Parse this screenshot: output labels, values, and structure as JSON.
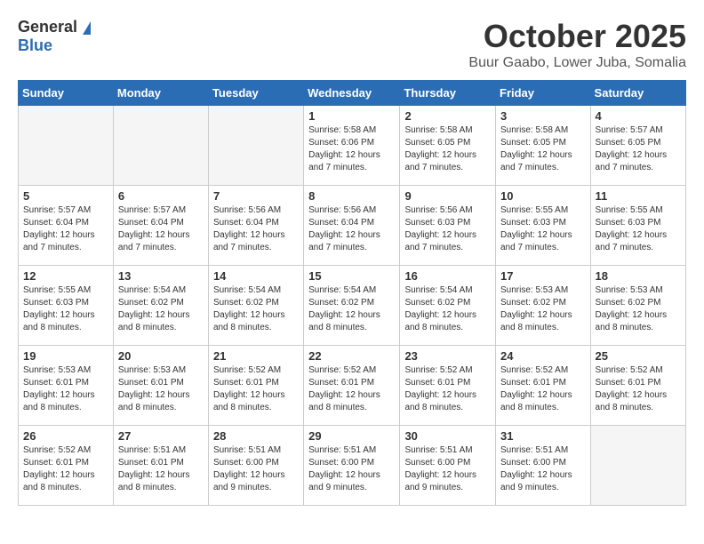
{
  "logo": {
    "general": "General",
    "blue": "Blue"
  },
  "header": {
    "month": "October 2025",
    "location": "Buur Gaabo, Lower Juba, Somalia"
  },
  "weekdays": [
    "Sunday",
    "Monday",
    "Tuesday",
    "Wednesday",
    "Thursday",
    "Friday",
    "Saturday"
  ],
  "weeks": [
    [
      {
        "day": "",
        "info": ""
      },
      {
        "day": "",
        "info": ""
      },
      {
        "day": "",
        "info": ""
      },
      {
        "day": "1",
        "info": "Sunrise: 5:58 AM\nSunset: 6:06 PM\nDaylight: 12 hours and 7 minutes."
      },
      {
        "day": "2",
        "info": "Sunrise: 5:58 AM\nSunset: 6:05 PM\nDaylight: 12 hours and 7 minutes."
      },
      {
        "day": "3",
        "info": "Sunrise: 5:58 AM\nSunset: 6:05 PM\nDaylight: 12 hours and 7 minutes."
      },
      {
        "day": "4",
        "info": "Sunrise: 5:57 AM\nSunset: 6:05 PM\nDaylight: 12 hours and 7 minutes."
      }
    ],
    [
      {
        "day": "5",
        "info": "Sunrise: 5:57 AM\nSunset: 6:04 PM\nDaylight: 12 hours and 7 minutes."
      },
      {
        "day": "6",
        "info": "Sunrise: 5:57 AM\nSunset: 6:04 PM\nDaylight: 12 hours and 7 minutes."
      },
      {
        "day": "7",
        "info": "Sunrise: 5:56 AM\nSunset: 6:04 PM\nDaylight: 12 hours and 7 minutes."
      },
      {
        "day": "8",
        "info": "Sunrise: 5:56 AM\nSunset: 6:04 PM\nDaylight: 12 hours and 7 minutes."
      },
      {
        "day": "9",
        "info": "Sunrise: 5:56 AM\nSunset: 6:03 PM\nDaylight: 12 hours and 7 minutes."
      },
      {
        "day": "10",
        "info": "Sunrise: 5:55 AM\nSunset: 6:03 PM\nDaylight: 12 hours and 7 minutes."
      },
      {
        "day": "11",
        "info": "Sunrise: 5:55 AM\nSunset: 6:03 PM\nDaylight: 12 hours and 7 minutes."
      }
    ],
    [
      {
        "day": "12",
        "info": "Sunrise: 5:55 AM\nSunset: 6:03 PM\nDaylight: 12 hours and 8 minutes."
      },
      {
        "day": "13",
        "info": "Sunrise: 5:54 AM\nSunset: 6:02 PM\nDaylight: 12 hours and 8 minutes."
      },
      {
        "day": "14",
        "info": "Sunrise: 5:54 AM\nSunset: 6:02 PM\nDaylight: 12 hours and 8 minutes."
      },
      {
        "day": "15",
        "info": "Sunrise: 5:54 AM\nSunset: 6:02 PM\nDaylight: 12 hours and 8 minutes."
      },
      {
        "day": "16",
        "info": "Sunrise: 5:54 AM\nSunset: 6:02 PM\nDaylight: 12 hours and 8 minutes."
      },
      {
        "day": "17",
        "info": "Sunrise: 5:53 AM\nSunset: 6:02 PM\nDaylight: 12 hours and 8 minutes."
      },
      {
        "day": "18",
        "info": "Sunrise: 5:53 AM\nSunset: 6:02 PM\nDaylight: 12 hours and 8 minutes."
      }
    ],
    [
      {
        "day": "19",
        "info": "Sunrise: 5:53 AM\nSunset: 6:01 PM\nDaylight: 12 hours and 8 minutes."
      },
      {
        "day": "20",
        "info": "Sunrise: 5:53 AM\nSunset: 6:01 PM\nDaylight: 12 hours and 8 minutes."
      },
      {
        "day": "21",
        "info": "Sunrise: 5:52 AM\nSunset: 6:01 PM\nDaylight: 12 hours and 8 minutes."
      },
      {
        "day": "22",
        "info": "Sunrise: 5:52 AM\nSunset: 6:01 PM\nDaylight: 12 hours and 8 minutes."
      },
      {
        "day": "23",
        "info": "Sunrise: 5:52 AM\nSunset: 6:01 PM\nDaylight: 12 hours and 8 minutes."
      },
      {
        "day": "24",
        "info": "Sunrise: 5:52 AM\nSunset: 6:01 PM\nDaylight: 12 hours and 8 minutes."
      },
      {
        "day": "25",
        "info": "Sunrise: 5:52 AM\nSunset: 6:01 PM\nDaylight: 12 hours and 8 minutes."
      }
    ],
    [
      {
        "day": "26",
        "info": "Sunrise: 5:52 AM\nSunset: 6:01 PM\nDaylight: 12 hours and 8 minutes."
      },
      {
        "day": "27",
        "info": "Sunrise: 5:51 AM\nSunset: 6:01 PM\nDaylight: 12 hours and 8 minutes."
      },
      {
        "day": "28",
        "info": "Sunrise: 5:51 AM\nSunset: 6:00 PM\nDaylight: 12 hours and 9 minutes."
      },
      {
        "day": "29",
        "info": "Sunrise: 5:51 AM\nSunset: 6:00 PM\nDaylight: 12 hours and 9 minutes."
      },
      {
        "day": "30",
        "info": "Sunrise: 5:51 AM\nSunset: 6:00 PM\nDaylight: 12 hours and 9 minutes."
      },
      {
        "day": "31",
        "info": "Sunrise: 5:51 AM\nSunset: 6:00 PM\nDaylight: 12 hours and 9 minutes."
      },
      {
        "day": "",
        "info": ""
      }
    ]
  ]
}
